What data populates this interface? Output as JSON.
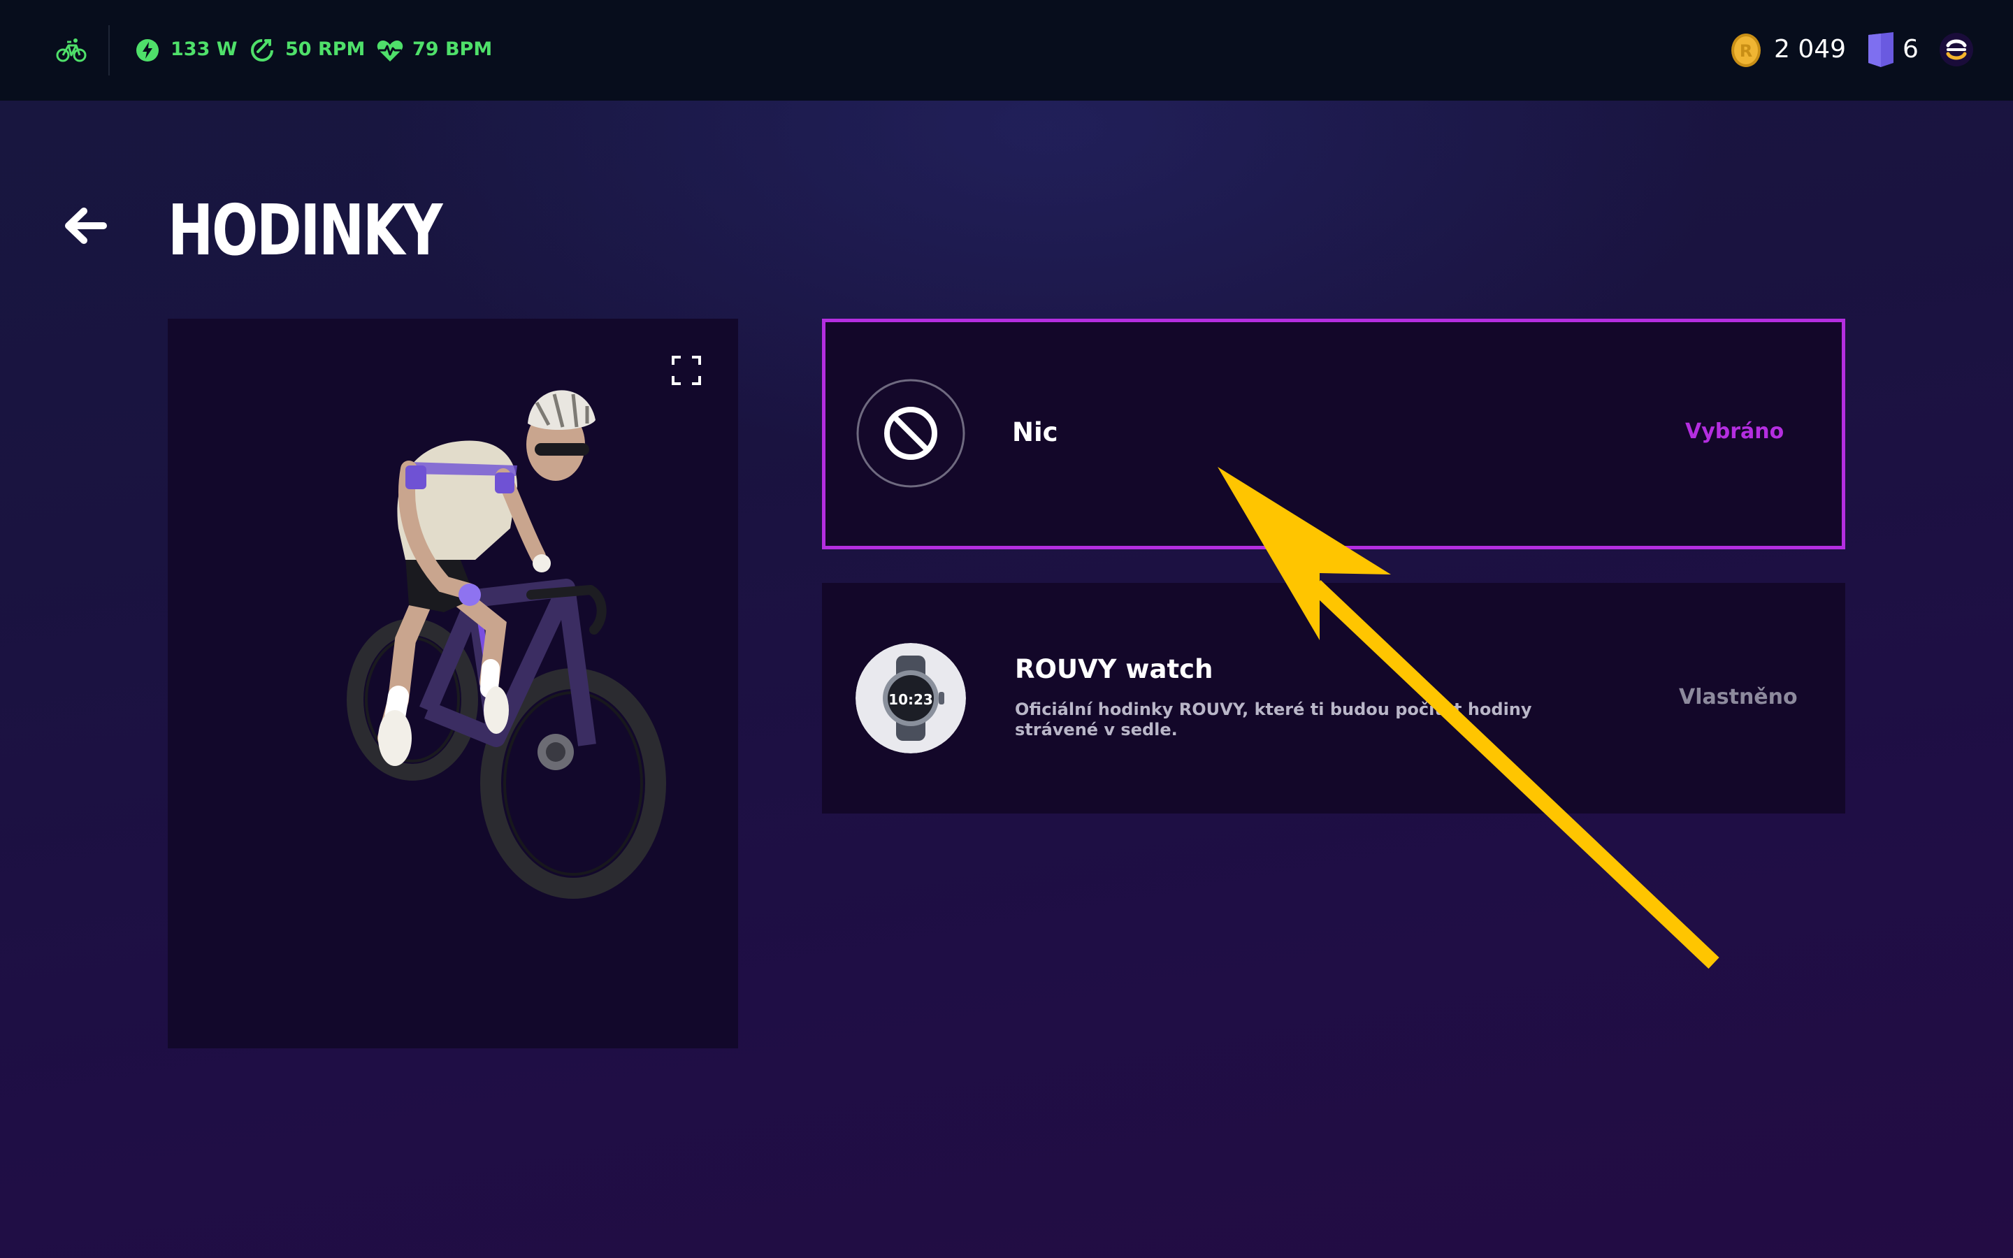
{
  "colors": {
    "accent": "#b42ee0",
    "metric_green": "#4fe06a",
    "arrow_yellow": "#ffc500",
    "topbar_bg": "#070d1c",
    "card_bg": "#130729"
  },
  "topbar": {
    "bike_icon": "bike-icon",
    "metrics": [
      {
        "icon": "power-bolt-icon",
        "value": "133 W"
      },
      {
        "icon": "cadence-icon",
        "value": "50 RPM"
      },
      {
        "icon": "heart-rate-icon",
        "value": "79 BPM"
      }
    ],
    "coins": {
      "icon": "coin-icon",
      "value": "2 049"
    },
    "badges": {
      "icon": "badge-icon",
      "value": "6"
    },
    "logo": "rouvy-logo"
  },
  "page": {
    "title": "HODINKY",
    "back_icon": "back-arrow-icon"
  },
  "preview": {
    "fullscreen_icon": "fullscreen-icon",
    "image": "cyclist-avatar"
  },
  "items": [
    {
      "name": "Nic",
      "description": "",
      "status": "Vybráno",
      "selected": true,
      "icon": "none-icon"
    },
    {
      "name": "ROUVY watch",
      "description": "Oficiální hodinky ROUVY, které ti budou počítat hodiny strávené v sedle.",
      "status": "Vlastněno",
      "selected": false,
      "icon": "watch-icon",
      "watch_face": "10:23"
    }
  ]
}
